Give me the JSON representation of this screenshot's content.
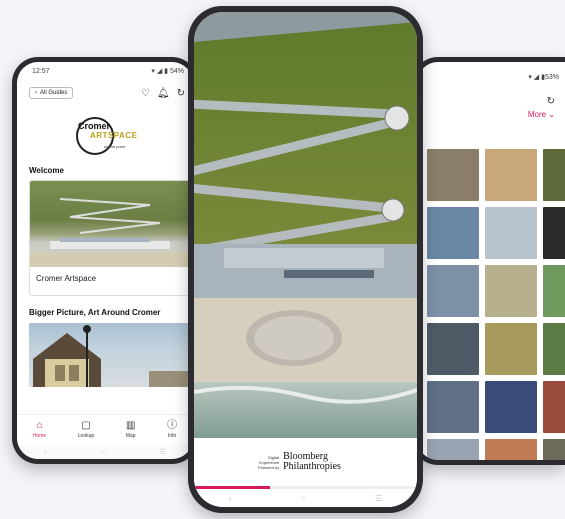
{
  "left_phone": {
    "status_time": "12:57",
    "status_battery": "54%",
    "back_label": "All Guides",
    "logo": {
      "line1": "Cromer",
      "line2": "ARTSPACE",
      "line3": "on the prom"
    },
    "section1_title": "Welcome",
    "card1_label": "Cromer Artspace",
    "section2_title": "Bigger Picture, Art Around Cromer",
    "nav": [
      {
        "label": "Home",
        "icon": "home-icon"
      },
      {
        "label": "Lookup",
        "icon": "lookup-icon"
      },
      {
        "label": "Map",
        "icon": "map-icon"
      },
      {
        "label": "Info",
        "icon": "info-icon"
      }
    ],
    "accent": "#d81b60"
  },
  "right_phone": {
    "status_battery": "53%",
    "more_label": "More",
    "tiles": [
      "#8a7e6a",
      "#c8a77a",
      "#5d6b3a",
      "#6a88a6",
      "#b9c2cf",
      "#2a2a2a",
      "#7c90a8",
      "#b6b08e",
      "#6f9a5e",
      "#4e5b66",
      "#a69a5c",
      "#5b7a46",
      "#5f6f86",
      "#3b4c7a",
      "#9a4b3c",
      "#9aa3b1",
      "#c07c54",
      "#6d6a5a"
    ]
  },
  "center_phone": {
    "powered_line1": "Digital",
    "powered_line2": "Experience",
    "powered_line3": "Powered by",
    "brand_line1": "Bloomberg",
    "brand_line2": "Philanthropies",
    "progress_fraction": 0.34
  }
}
